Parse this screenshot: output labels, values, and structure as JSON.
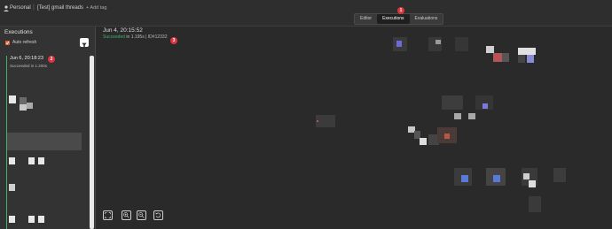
{
  "topbar": {
    "project": "Personal",
    "workflow_name": "[Test] gmail threads",
    "add_tag": "+ Add tag"
  },
  "tabs": [
    {
      "label": "Editor",
      "active": false
    },
    {
      "label": "Executions",
      "active": true
    },
    {
      "label": "Evaluations",
      "active": false
    }
  ],
  "badges": {
    "tabs": "1",
    "item": "2",
    "canvas": "3"
  },
  "sidebar": {
    "title": "Executions",
    "auto_refresh": "Auto refresh",
    "auto_refresh_checked": true,
    "items": [
      {
        "date": "Jun 6, 20:18:23",
        "status": "Succeeded in 1.200s"
      }
    ]
  },
  "canvas": {
    "date": "Jun 4, 20:15:52",
    "status_prefix": "Succeeded",
    "status_rest": " in 1.195s | ID#12332"
  },
  "controls": [
    "fit-view",
    "zoom-in",
    "zoom-out",
    "reset-zoom"
  ],
  "colors": {
    "accent": "#d9363e",
    "success": "#3fb36a",
    "checkbox": "#e0663a"
  }
}
